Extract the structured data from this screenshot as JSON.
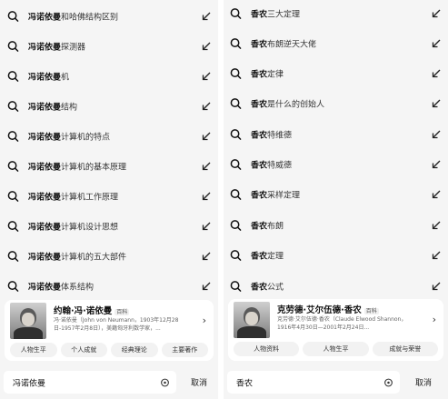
{
  "left": {
    "suggestions": [
      {
        "highlight": "冯诺依曼",
        "rest": "和哈佛结构区别"
      },
      {
        "highlight": "冯诺依曼",
        "rest": "探测器"
      },
      {
        "highlight": "冯诺依曼",
        "rest": "机"
      },
      {
        "highlight": "冯诺依曼",
        "rest": "结构"
      },
      {
        "highlight": "冯诺依曼",
        "rest": "计算机的特点"
      },
      {
        "highlight": "冯诺依曼",
        "rest": "计算机的基本原理"
      },
      {
        "highlight": "冯诺依曼",
        "rest": "计算机工作原理"
      },
      {
        "highlight": "冯诺依曼",
        "rest": "计算机设计思想"
      },
      {
        "highlight": "冯诺依曼",
        "rest": "计算机的五大部件"
      },
      {
        "highlight": "冯诺依曼",
        "rest": "体系结构"
      }
    ],
    "card": {
      "name": "约翰·冯·诺依曼",
      "badge": "百科",
      "desc": "冯·诺依曼（John von Neumann，1903年12月28日-1957年2月8日），美籍匈牙利数学家，...",
      "tags": [
        "人物生平",
        "个人成就",
        "经典理论",
        "主要著作"
      ]
    },
    "search_value": "冯诺依曼",
    "cancel_label": "取消"
  },
  "right": {
    "suggestions": [
      {
        "highlight": "香农",
        "rest": "三大定理"
      },
      {
        "highlight": "香农",
        "rest": "布朗逆天大佬"
      },
      {
        "highlight": "香农",
        "rest": "定律"
      },
      {
        "highlight": "香农",
        "rest": "是什么的创始人"
      },
      {
        "highlight": "香农",
        "rest": "特维德"
      },
      {
        "highlight": "香农",
        "rest": "特威德"
      },
      {
        "highlight": "香农",
        "rest": "采样定理"
      },
      {
        "highlight": "香农",
        "rest": "布朗"
      },
      {
        "highlight": "香农",
        "rest": "定理"
      },
      {
        "highlight": "香农",
        "rest": "公式"
      }
    ],
    "card": {
      "name": "克劳德·艾尔伍德·香农",
      "badge": "百科",
      "desc": "克劳德·艾尔伍德·香农（Claude Elwood Shannon，1916年4月30日—2001年2月24日...",
      "tags": [
        "人物资料",
        "人物生平",
        "成就与荣誉"
      ]
    },
    "search_value": "香农",
    "cancel_label": "取消"
  }
}
